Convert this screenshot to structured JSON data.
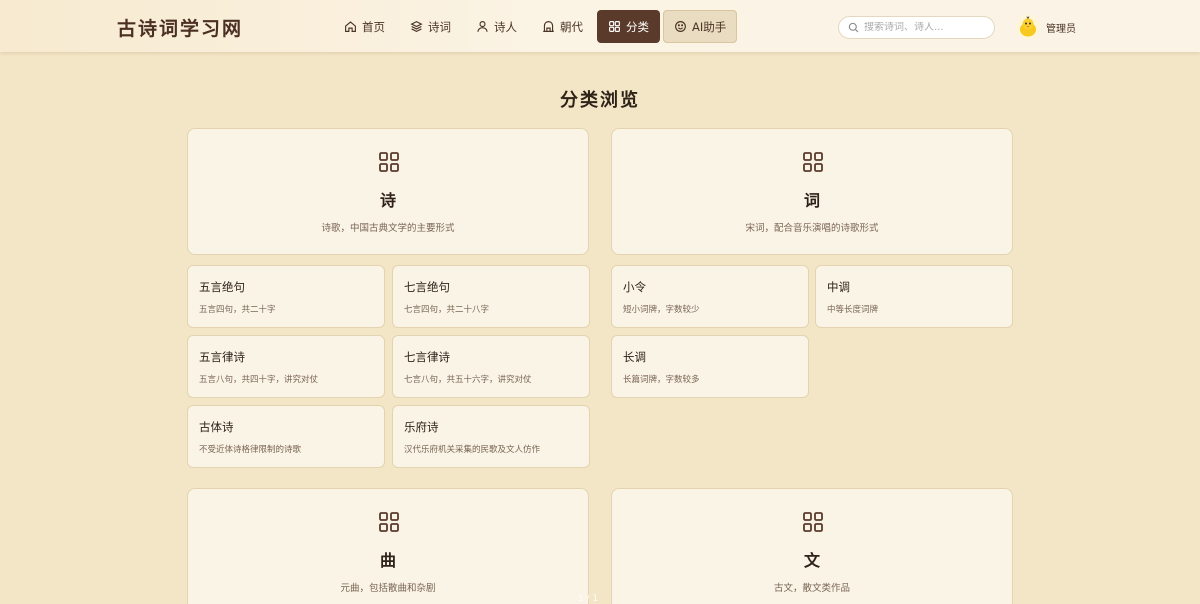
{
  "header": {
    "logo": "古诗词学习网",
    "nav": [
      {
        "label": "首页",
        "icon": "home-icon"
      },
      {
        "label": "诗词",
        "icon": "layers-icon"
      },
      {
        "label": "诗人",
        "icon": "user-icon"
      },
      {
        "label": "朝代",
        "icon": "temple-icon"
      },
      {
        "label": "分类",
        "icon": "grid-icon",
        "active": true
      },
      {
        "label": "AI助手",
        "icon": "smile-icon"
      }
    ],
    "search_placeholder": "搜索诗词、诗人...",
    "user_name": "管理员"
  },
  "page_title": "分类浏览",
  "categories": [
    {
      "name": "诗",
      "desc": "诗歌，中国古典文学的主要形式",
      "subs": [
        {
          "name": "五言绝句",
          "desc": "五言四句，共二十字"
        },
        {
          "name": "七言绝句",
          "desc": "七言四句，共二十八字"
        },
        {
          "name": "五言律诗",
          "desc": "五言八句，共四十字，讲究对仗"
        },
        {
          "name": "七言律诗",
          "desc": "七言八句，共五十六字，讲究对仗"
        },
        {
          "name": "古体诗",
          "desc": "不受近体诗格律限制的诗歌"
        },
        {
          "name": "乐府诗",
          "desc": "汉代乐府机关采集的民歌及文人仿作"
        }
      ]
    },
    {
      "name": "词",
      "desc": "宋词，配合音乐演唱的诗歌形式",
      "subs": [
        {
          "name": "小令",
          "desc": "短小词牌，字数较少"
        },
        {
          "name": "中调",
          "desc": "中等长度词牌"
        },
        {
          "name": "长调",
          "desc": "长篇词牌，字数较多"
        }
      ]
    },
    {
      "name": "曲",
      "desc": "元曲，包括散曲和杂剧"
    },
    {
      "name": "文",
      "desc": "古文，散文类作品"
    }
  ],
  "page_indicator": "1 / 1",
  "colors": {
    "background": "#f3e6c6",
    "card": "#faf4e6",
    "accent": "#5a3a2a",
    "ai_button": "#eadcc0",
    "text_dark": "#2f2218"
  }
}
